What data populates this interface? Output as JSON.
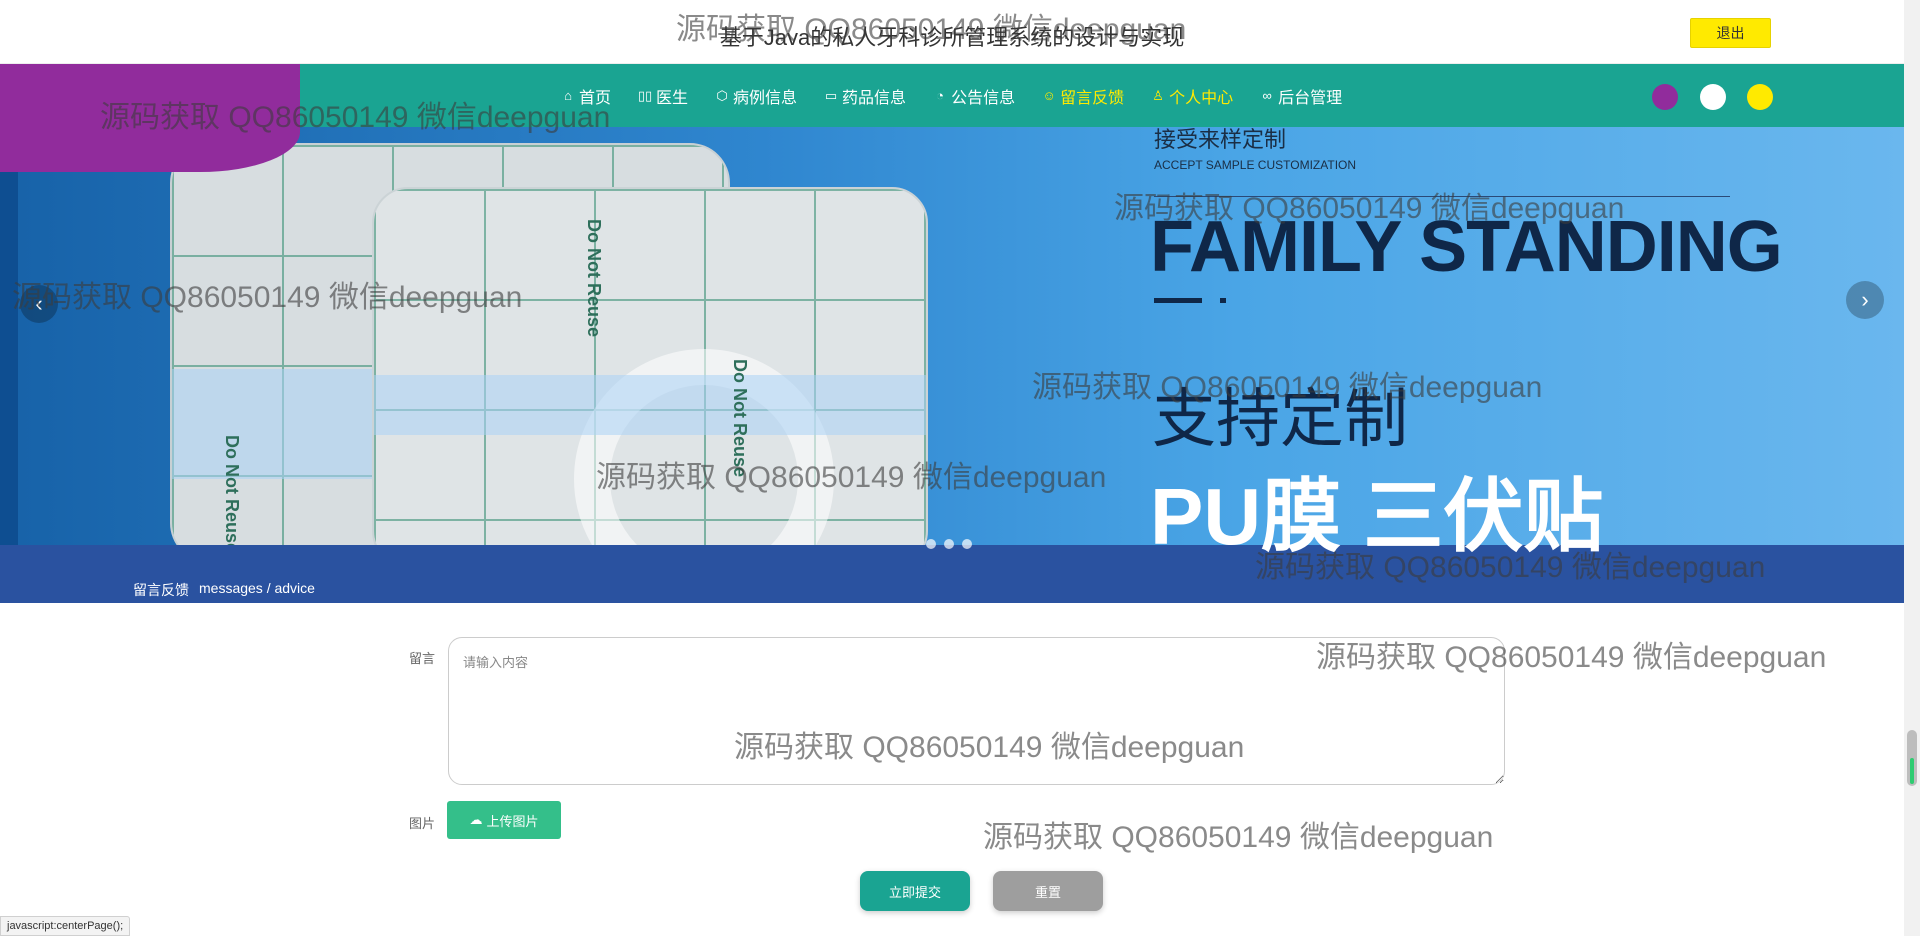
{
  "header": {
    "title": "基于Java的私人牙科诊所管理系统的设计与实现",
    "logout_label": "退出"
  },
  "nav": {
    "items": [
      {
        "label": "首页",
        "icon": "home-icon",
        "glyph": "⌂"
      },
      {
        "label": "医生",
        "icon": "doctor-icon",
        "glyph": "▯▯"
      },
      {
        "label": "病例信息",
        "icon": "cube-icon",
        "glyph": "⬡"
      },
      {
        "label": "药品信息",
        "icon": "note-icon",
        "glyph": "▭"
      },
      {
        "label": "公告信息",
        "icon": "gauge-icon",
        "glyph": "◔"
      },
      {
        "label": "留言反馈",
        "icon": "smile-icon",
        "glyph": "☺"
      },
      {
        "label": "个人中心",
        "icon": "user-icon",
        "glyph": "♙"
      },
      {
        "label": "后台管理",
        "icon": "link-icon",
        "glyph": "∞"
      }
    ],
    "theme_dots": [
      "#912c9c",
      "#ffffff",
      "#ffea00"
    ]
  },
  "banner": {
    "accept_cn": "接受来样定制",
    "accept_en": "ACCEPT SAMPLE CUSTOMIZATION",
    "headline": "FAMILY STANDING",
    "support": "支持定制",
    "product": "PU膜 三伏贴",
    "stamp_text": "Do Not Reuse",
    "prev_glyph": "‹",
    "next_glyph": "›"
  },
  "section": {
    "title": "留言反馈",
    "subtitle": "messages / advice"
  },
  "form": {
    "message_label": "留言",
    "message_placeholder": "请输入内容",
    "message_value": "",
    "image_label": "图片",
    "upload_label": "上传图片",
    "submit_label": "立即提交",
    "reset_label": "重置"
  },
  "status_bar": {
    "text": "javascript:centerPage();"
  },
  "watermark": "源码获取 QQ86050149 微信deepguan",
  "colors": {
    "nav_bg": "#1aa492",
    "accent_purple": "#912c9c",
    "accent_yellow": "#ffea00",
    "section_bg": "#2a52a0",
    "upload_green": "#34bf8a",
    "reset_grey": "#9e9e9e"
  }
}
